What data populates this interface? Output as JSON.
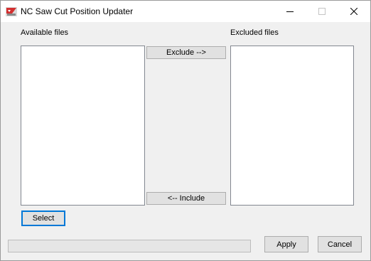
{
  "window": {
    "title": "NC Saw Cut Position Updater",
    "icons": {
      "app": "saw-app-icon",
      "minimize": "minimize-icon",
      "maximize": "maximize-icon",
      "close": "close-icon"
    }
  },
  "available": {
    "label": "Available files",
    "items": []
  },
  "excluded": {
    "label": "Excluded files",
    "items": []
  },
  "buttons": {
    "exclude": "Exclude -->",
    "include": "<-- Include",
    "select": "Select",
    "apply": "Apply",
    "cancel": "Cancel"
  },
  "progress": {
    "value": 0
  }
}
